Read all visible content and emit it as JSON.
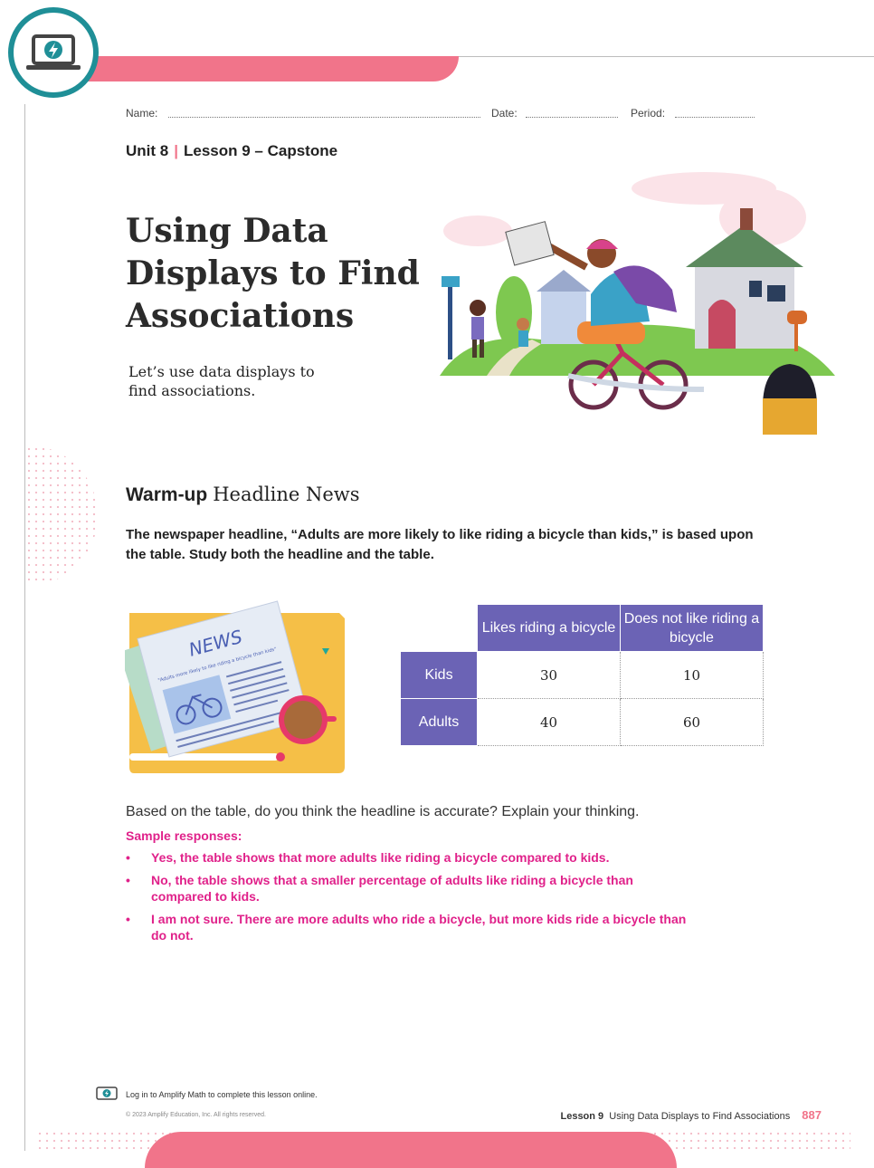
{
  "header": {
    "name_label": "Name:",
    "date_label": "Date:",
    "period_label": "Period:"
  },
  "unit": {
    "unit": "Unit 8",
    "separator": "|",
    "lesson": "Lesson 9 – Capstone"
  },
  "title": "Using Data Displays to Find Associations",
  "subtitle": "Let’s use data displays to find associations.",
  "warmup": {
    "label": "Warm-up",
    "heading": "Headline News",
    "prompt": "The newspaper headline, “Adults are more likely to like riding a bicycle than kids,” is based upon the table. Study both the headline and the table."
  },
  "newspaper": {
    "masthead": "NEWS",
    "headline": "\"Adults more likely to like riding a bicycle than kids\""
  },
  "table": {
    "columns": [
      "Likes riding a bicycle",
      "Does not like riding a bicycle"
    ],
    "rows": [
      {
        "label": "Kids",
        "values": [
          "30",
          "10"
        ]
      },
      {
        "label": "Adults",
        "values": [
          "40",
          "60"
        ]
      }
    ]
  },
  "question": "Based on the table, do you think the headline is accurate? Explain your thinking.",
  "sample_label": "Sample responses:",
  "responses": [
    "Yes, the table shows that more adults like riding a bicycle compared to kids.",
    "No, the table shows that a smaller percentage of adults like riding a bicycle than compared to kids.",
    "I am not sure. There are more adults who ride a bicycle, but more kids ride a bicycle than do not."
  ],
  "footer": {
    "login_text": "Log in to Amplify Math to complete this lesson online.",
    "copyright": "© 2023 Amplify Education, Inc. All rights reserved.",
    "lesson_label": "Lesson 9",
    "lesson_title": "Using Data Displays to Find Associations",
    "page_number": "887"
  },
  "colors": {
    "accent_pink": "#f1748a",
    "teal": "#1f8f97",
    "table_purple": "#6b63b5",
    "answer_magenta": "#e0218a"
  },
  "icons": [
    "laptop-lightning-icon",
    "newspaper-illustration",
    "cyclist-illustration"
  ]
}
